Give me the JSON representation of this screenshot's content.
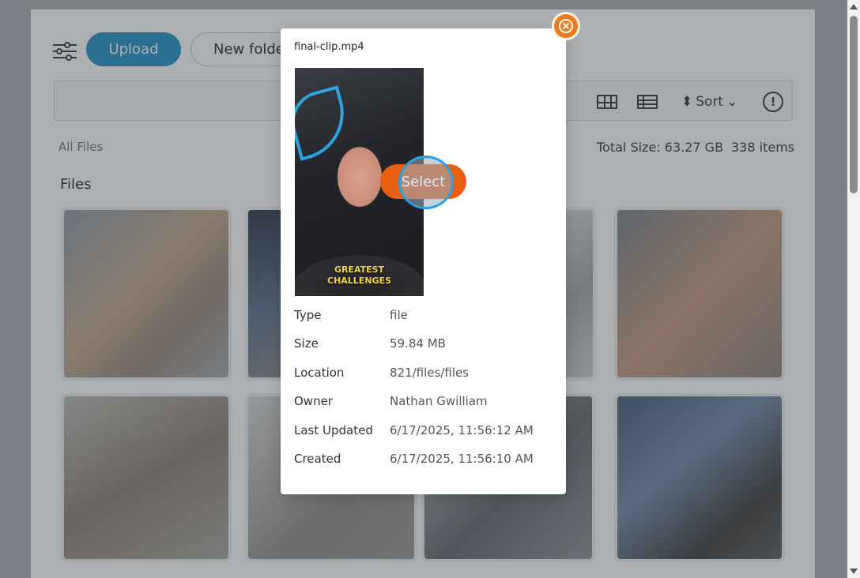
{
  "toolbar": {
    "upload_label": "Upload",
    "new_folder_label": "New folder",
    "sort_label": "Sort",
    "info_icon": "!"
  },
  "summary": {
    "breadcrumb": "All Files",
    "total_size": "Total Size: 63.27 GB",
    "item_count": "338 items",
    "files_heading": "Files"
  },
  "modal": {
    "title": "final-clip.mp4",
    "preview_caption_line1": "GREATEST",
    "preview_caption_line2": "CHALLENGES",
    "select_label": "Select",
    "details": [
      {
        "key": "Type",
        "value": "file"
      },
      {
        "key": "Size",
        "value": "59.84 MB"
      },
      {
        "key": "Location",
        "value": "821/files/files"
      },
      {
        "key": "Owner",
        "value": "Nathan Gwilliam"
      },
      {
        "key": "Last Updated",
        "value": "6/17/2025, 11:56:12 AM"
      },
      {
        "key": "Created",
        "value": "6/17/2025, 11:56:10 AM"
      }
    ]
  },
  "colors": {
    "upload": "#1f8fc4",
    "select": "#e95f12",
    "close": "#f07a1c",
    "click_ring": "#2aa0e6"
  },
  "icons": {
    "filter": "sliders-icon",
    "grid": "grid-view-icon",
    "list": "list-view-icon",
    "sort": "sort-icon",
    "info": "info-icon",
    "close": "close-circle-icon"
  }
}
